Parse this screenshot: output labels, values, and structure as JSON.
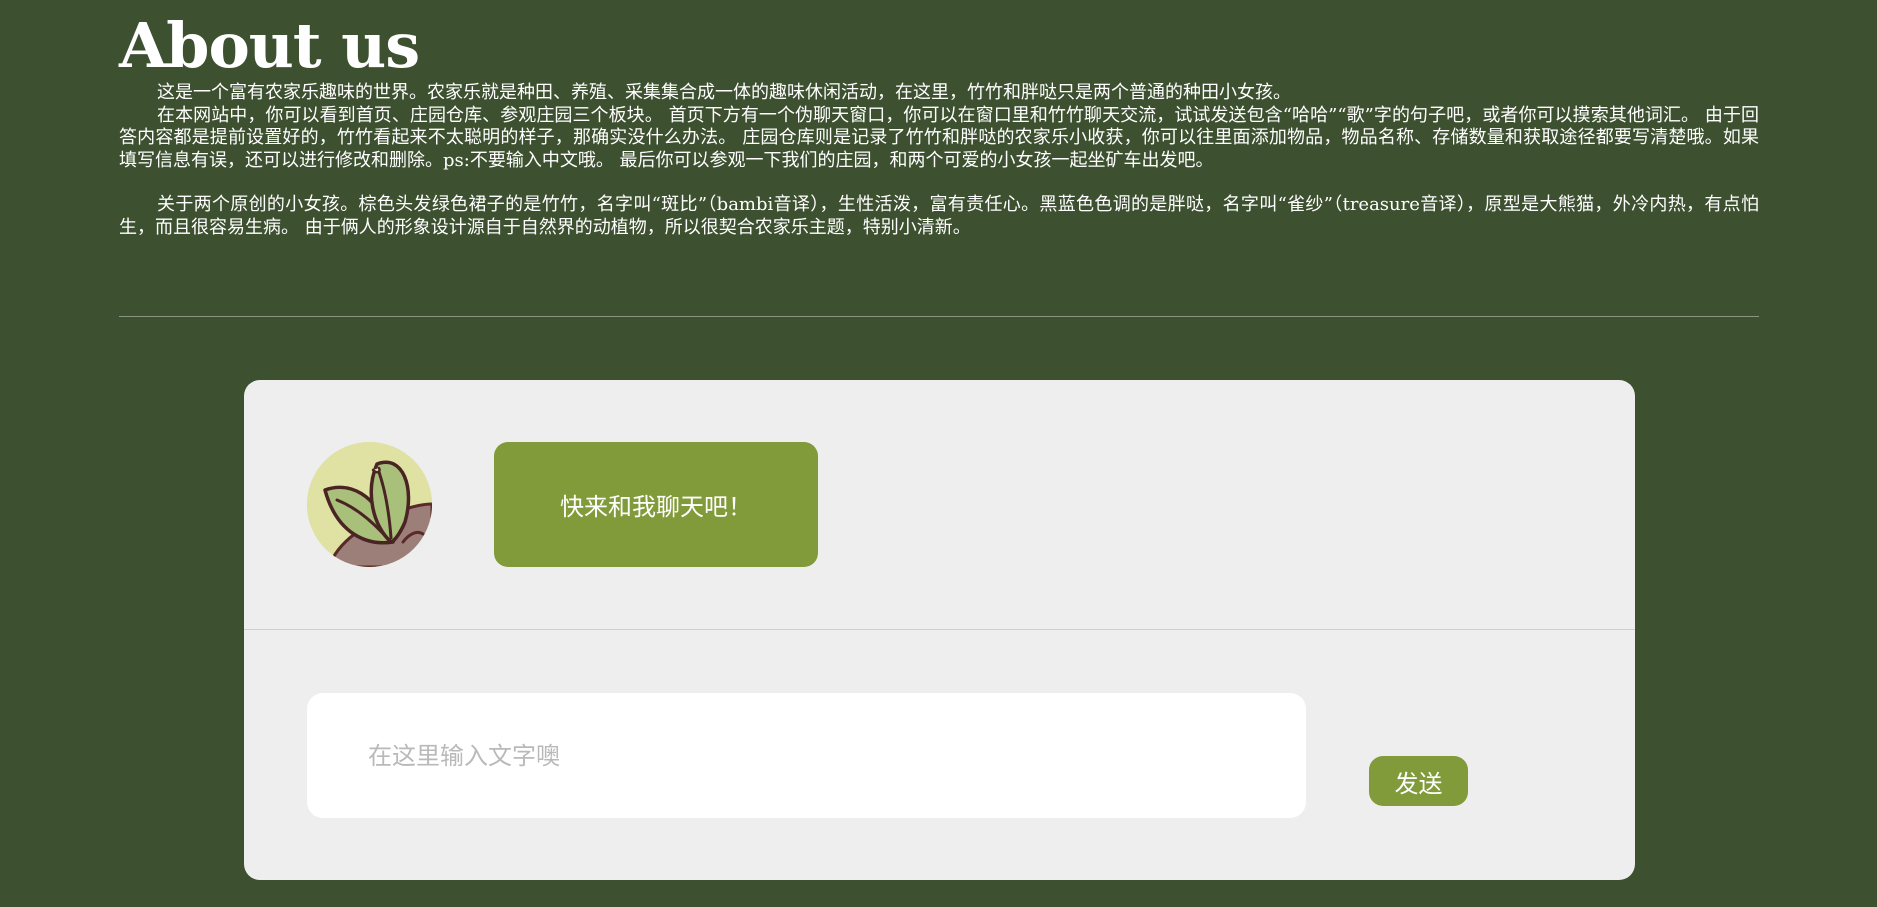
{
  "about": {
    "title": "About us",
    "paragraphs": [
      "这是一个富有农家乐趣味的世界。农家乐就是种田、养殖、采集集合成一体的趣味休闲活动，在这里，竹竹和胖哒只是两个普通的种田小女孩。",
      "在本网站中，你可以看到首页、庄园仓库、参观庄园三个板块。 首页下方有一个伪聊天窗口，你可以在窗口里和竹竹聊天交流，试试发送包含“哈哈”“歌”字的句子吧，或者你可以摸索其他词汇。 由于回答内容都是提前设置好的，竹竹看起来不太聪明的样子，那确实没什么办法。 庄园仓库则是记录了竹竹和胖哒的农家乐小收获，你可以往里面添加物品，物品名称、存储数量和获取途径都要写清楚哦。如果填写信息有误，还可以进行修改和删除。ps:不要输入中文哦。 最后你可以参观一下我们的庄园，和两个可爱的小女孩一起坐矿车出发吧。",
      "关于两个原创的小女孩。棕色头发绿色裙子的是竹竹，名字叫“斑比”（bambi音译），生性活泼，富有责任心。黑蓝色色调的是胖哒，名字叫“雀纱”（treasure音译），原型是大熊猫，外冷内热，有点怕生，而且很容易生病。 由于俩人的形象设计源自于自然界的动植物，所以很契合农家乐主题，特别小清新。"
    ]
  },
  "chat": {
    "avatar_icon": "leaf-avatar-icon",
    "bot_message": "快来和我聊天吧！",
    "input_placeholder": "在这里输入文字噢",
    "input_value": "",
    "send_label": "发送"
  },
  "colors": {
    "page_background": "#3d5030",
    "panel_background": "#eeeeee",
    "accent_green": "#819b3a",
    "avatar_background": "#dfe2a2"
  }
}
